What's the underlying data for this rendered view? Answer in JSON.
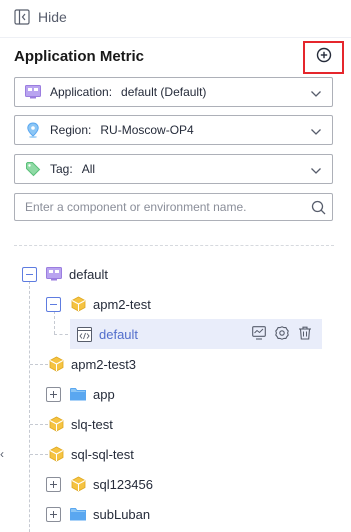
{
  "panel": {
    "hide_label": "Hide",
    "title": "Application Metric"
  },
  "filters": {
    "application": {
      "label": "Application:",
      "value": "default (Default)",
      "icon": "application-grid-icon"
    },
    "region": {
      "label": "Region:",
      "value": "RU-Moscow-OP4",
      "icon": "location-pin-icon"
    },
    "tag": {
      "label": "Tag:",
      "value": "All",
      "icon": "tag-icon"
    }
  },
  "search": {
    "placeholder": "Enter a component or environment name."
  },
  "tree": {
    "root": {
      "label": "default",
      "icon": "application-grid-icon",
      "expanded": true
    },
    "nodes": [
      {
        "label": "apm2-test",
        "icon": "component-cube-icon",
        "toggle": "expanded"
      },
      {
        "label": "default",
        "icon": "environment-code-icon",
        "selected": true
      },
      {
        "label": "apm2-test3",
        "icon": "component-cube-icon",
        "toggle": "none"
      },
      {
        "label": "app",
        "icon": "folder-icon",
        "toggle": "collapsed"
      },
      {
        "label": "slq-test",
        "icon": "component-cube-icon",
        "toggle": "none"
      },
      {
        "label": "sql-sql-test",
        "icon": "component-cube-icon",
        "toggle": "none"
      },
      {
        "label": "sql123456",
        "icon": "component-cube-icon",
        "toggle": "collapsed"
      },
      {
        "label": "subLuban",
        "icon": "folder-icon",
        "toggle": "collapsed"
      }
    ]
  },
  "edge_mark": "‹",
  "colors": {
    "accent": "#526ecc",
    "selected_bg": "#e9edfa",
    "highlight_border": "#e5262c",
    "cube": "#f5c342",
    "folder": "#5aa7f0",
    "app_icon": "#9b7ddf",
    "tag": "#5cc07a",
    "pin": "#5aa7f0"
  }
}
